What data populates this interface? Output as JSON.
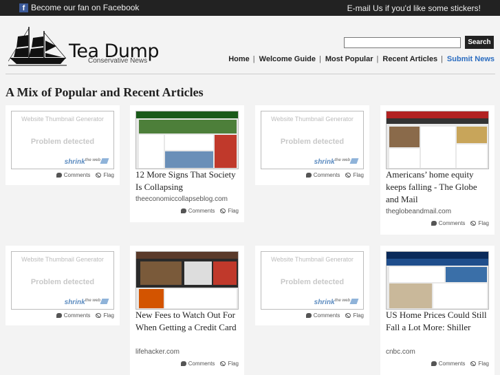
{
  "topbar": {
    "facebook_text": "Become our fan on Facebook",
    "email_text": "E-mail Us if you'd like some stickers!"
  },
  "header": {
    "logo_title": "Tea Dump",
    "logo_subtitle": "Conservative News",
    "search_value": "",
    "search_button": "Search"
  },
  "nav": [
    {
      "label": "Home"
    },
    {
      "label": "Welcome Guide"
    },
    {
      "label": "Most Popular"
    },
    {
      "label": "Recent Articles"
    },
    {
      "label": "Submit News"
    }
  ],
  "page_heading": "A Mix of Popular and Recent Articles",
  "thumb_generator": {
    "line1": "Website Thumbnail Generator",
    "line2": "Problem detected",
    "brand": "shrink",
    "brand_sup": "the web"
  },
  "card_actions": {
    "comments": "Comments",
    "flag": "Flag"
  },
  "articles": [
    {
      "title": "",
      "domain": ""
    },
    {
      "title": "12 More Signs That Society Is Collapsing",
      "domain": "theeconomiccollapseblog.com"
    },
    {
      "title": "",
      "domain": ""
    },
    {
      "title": "Americans’ home equity keeps falling - The Globe and Mail",
      "domain": "theglobeandmail.com"
    },
    {
      "title": "",
      "domain": ""
    },
    {
      "title": "New Fees to Watch Out For When Getting a Credit Card",
      "domain": "lifehacker.com"
    },
    {
      "title": "",
      "domain": ""
    },
    {
      "title": "US Home Prices Could Still Fall a Lot More: Shiller",
      "domain": "cnbc.com"
    }
  ]
}
